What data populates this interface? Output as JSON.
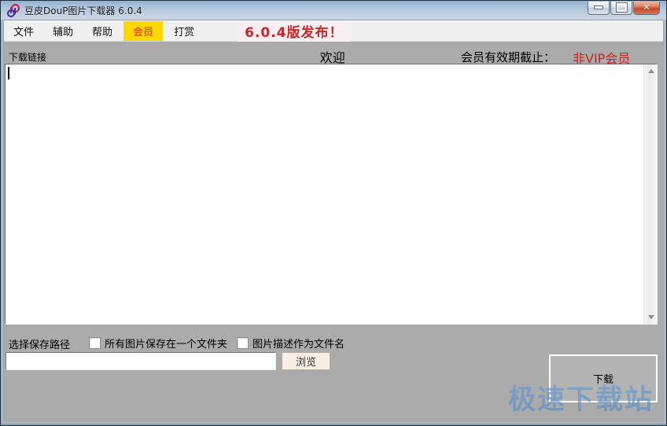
{
  "window": {
    "title": "豆皮DouP图片下载器 6.0.4",
    "controls": {
      "close_glyph": "✕"
    }
  },
  "menu": {
    "items": [
      {
        "label": "文件"
      },
      {
        "label": "辅助"
      },
      {
        "label": "帮助"
      },
      {
        "label": "会员",
        "highlighted": true
      },
      {
        "label": "打赏"
      }
    ]
  },
  "banner": {
    "text": "6.0.4版发布！",
    "text_color": "#d02424",
    "bg_color": "#f6eef1"
  },
  "header": {
    "links_label": "下载链接",
    "welcome": "欢迎",
    "member_expiry_label": "会员有效期截止：",
    "member_status": "非VIP会员",
    "member_status_color": "#cc2222"
  },
  "editor": {
    "value": ""
  },
  "save": {
    "path_label": "选择保存路径",
    "options": [
      {
        "label": "所有图片保存在一个文件夹",
        "checked": false
      },
      {
        "label": "图片描述作为文件名",
        "checked": false
      }
    ],
    "path_value": "",
    "browse_label": "浏览"
  },
  "download": {
    "label": "下载"
  },
  "watermark": {
    "text": "极速下载站"
  },
  "colors": {
    "client_bg": "#ababab",
    "menubar_bg": "#f0f0f0",
    "member_highlight_bg": "#ffd800",
    "titlebar_gradient_top": "#93b1cf",
    "titlebar_gradient_bottom": "#ccd4dd"
  }
}
